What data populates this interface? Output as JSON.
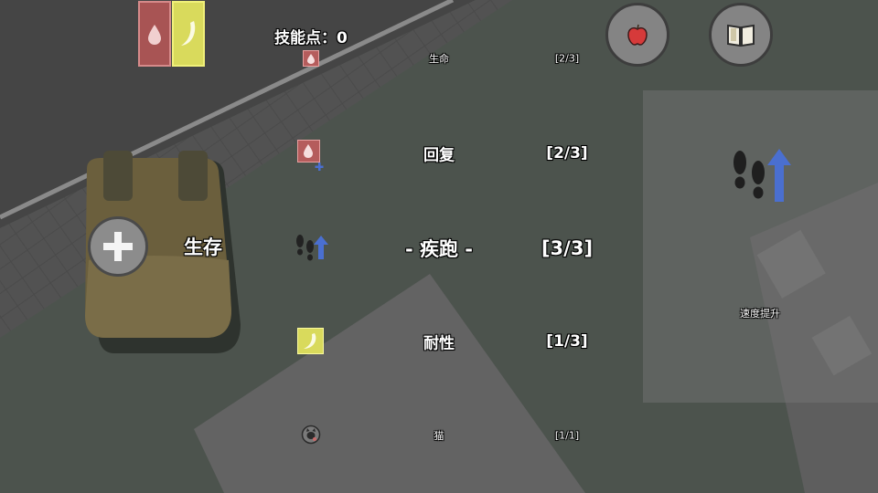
{
  "hud": {
    "skill_points_label": "技能点：0",
    "category_label": "生存"
  },
  "skills": [
    {
      "name": "生命",
      "level": "[2/3]",
      "icon": "blood-drop-icon"
    },
    {
      "name": "回复",
      "level": "[2/3]",
      "icon": "blood-regen-icon"
    },
    {
      "name": "- 疾跑 -",
      "level": "[3/3]",
      "icon": "footsteps-up-icon"
    },
    {
      "name": "耐性",
      "level": "[1/3]",
      "icon": "banana-icon"
    },
    {
      "name": "猫",
      "level": "[1/1]",
      "icon": "cat-icon"
    }
  ],
  "detail": {
    "icon": "footsteps-up-icon",
    "description": "速度提升"
  },
  "buttons": {
    "food": "apple-icon",
    "journal": "book-icon",
    "add": "plus-icon"
  },
  "status_bars": [
    {
      "name": "health",
      "icon": "blood-drop-icon",
      "color": "#c86b6b"
    },
    {
      "name": "stamina",
      "icon": "banana-icon",
      "color": "#d9da5c"
    }
  ]
}
